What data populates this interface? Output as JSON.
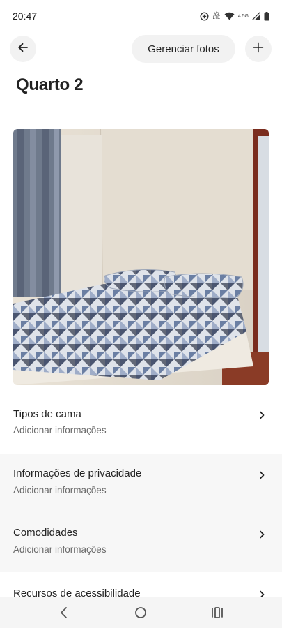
{
  "status_bar": {
    "time": "20:47",
    "network_label": "4.5G",
    "volte_label": "Vo LTE",
    "icons": [
      "data-saver-icon",
      "volte-icon",
      "wifi-icon",
      "signal-icon",
      "battery-icon"
    ]
  },
  "header": {
    "back_icon": "arrow-left-icon",
    "manage_photos_label": "Gerenciar fotos",
    "add_icon": "plus-icon"
  },
  "page": {
    "title": "Quarto 2"
  },
  "photo": {
    "subject": "bed-photo"
  },
  "rows": [
    {
      "title": "Tipos de cama",
      "subtitle": "Adicionar informações"
    },
    {
      "title": "Informações de privacidade",
      "subtitle": "Adicionar informações"
    },
    {
      "title": "Comodidades",
      "subtitle": "Adicionar informações"
    },
    {
      "title": "Recursos de acessibilidade"
    }
  ],
  "nav_bar": {
    "icons": [
      "back-nav-icon",
      "home-nav-icon",
      "recents-nav-icon"
    ]
  },
  "colors": {
    "text_primary": "#222222",
    "text_secondary": "#6a6a6a",
    "button_bg": "#f2f2f2",
    "row_highlight": "#f7f7f7"
  }
}
